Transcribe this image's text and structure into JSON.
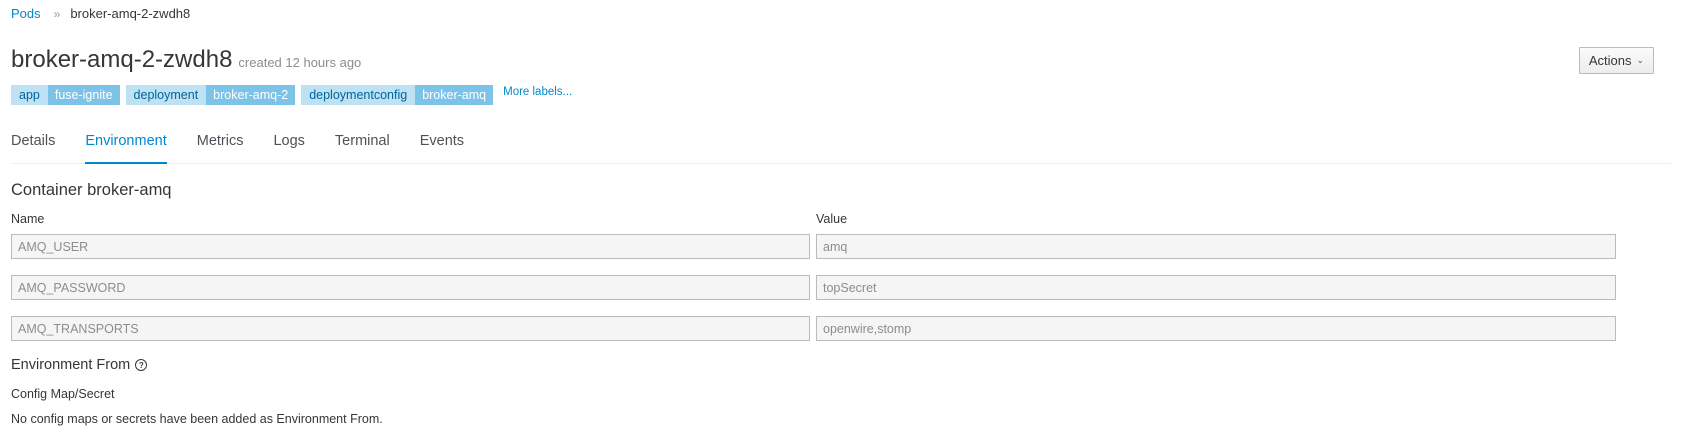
{
  "breadcrumb": {
    "parent": "Pods",
    "separator": "»",
    "current": "broker-amq-2-zwdh8"
  },
  "header": {
    "title": "broker-amq-2-zwdh8",
    "created": "created 12 hours ago",
    "actions_label": "Actions",
    "actions_caret_icon": "chevron-down-icon"
  },
  "labels": [
    {
      "key": "app",
      "value": "fuse-ignite"
    },
    {
      "key": "deployment",
      "value": "broker-amq-2"
    },
    {
      "key": "deploymentconfig",
      "value": "broker-amq"
    }
  ],
  "more_labels": "More labels...",
  "tabs": [
    {
      "label": "Details",
      "active": false
    },
    {
      "label": "Environment",
      "active": true
    },
    {
      "label": "Metrics",
      "active": false
    },
    {
      "label": "Logs",
      "active": false
    },
    {
      "label": "Terminal",
      "active": false
    },
    {
      "label": "Events",
      "active": false
    }
  ],
  "container": {
    "title": "Container broker-amq",
    "name_header": "Name",
    "value_header": "Value",
    "env": [
      {
        "name": "AMQ_USER",
        "value": "amq"
      },
      {
        "name": "AMQ_PASSWORD",
        "value": "topSecret"
      },
      {
        "name": "AMQ_TRANSPORTS",
        "value": "openwire,stomp"
      }
    ]
  },
  "env_from": {
    "title": "Environment From",
    "help_icon": "question-circle-icon",
    "column_label": "Config Map/Secret",
    "empty_text": "No config maps or secrets have been added as Environment From."
  },
  "colors": {
    "link": "#0088ce",
    "label_key_bg": "#bee1f4",
    "label_value_bg": "#7dc3e8"
  }
}
